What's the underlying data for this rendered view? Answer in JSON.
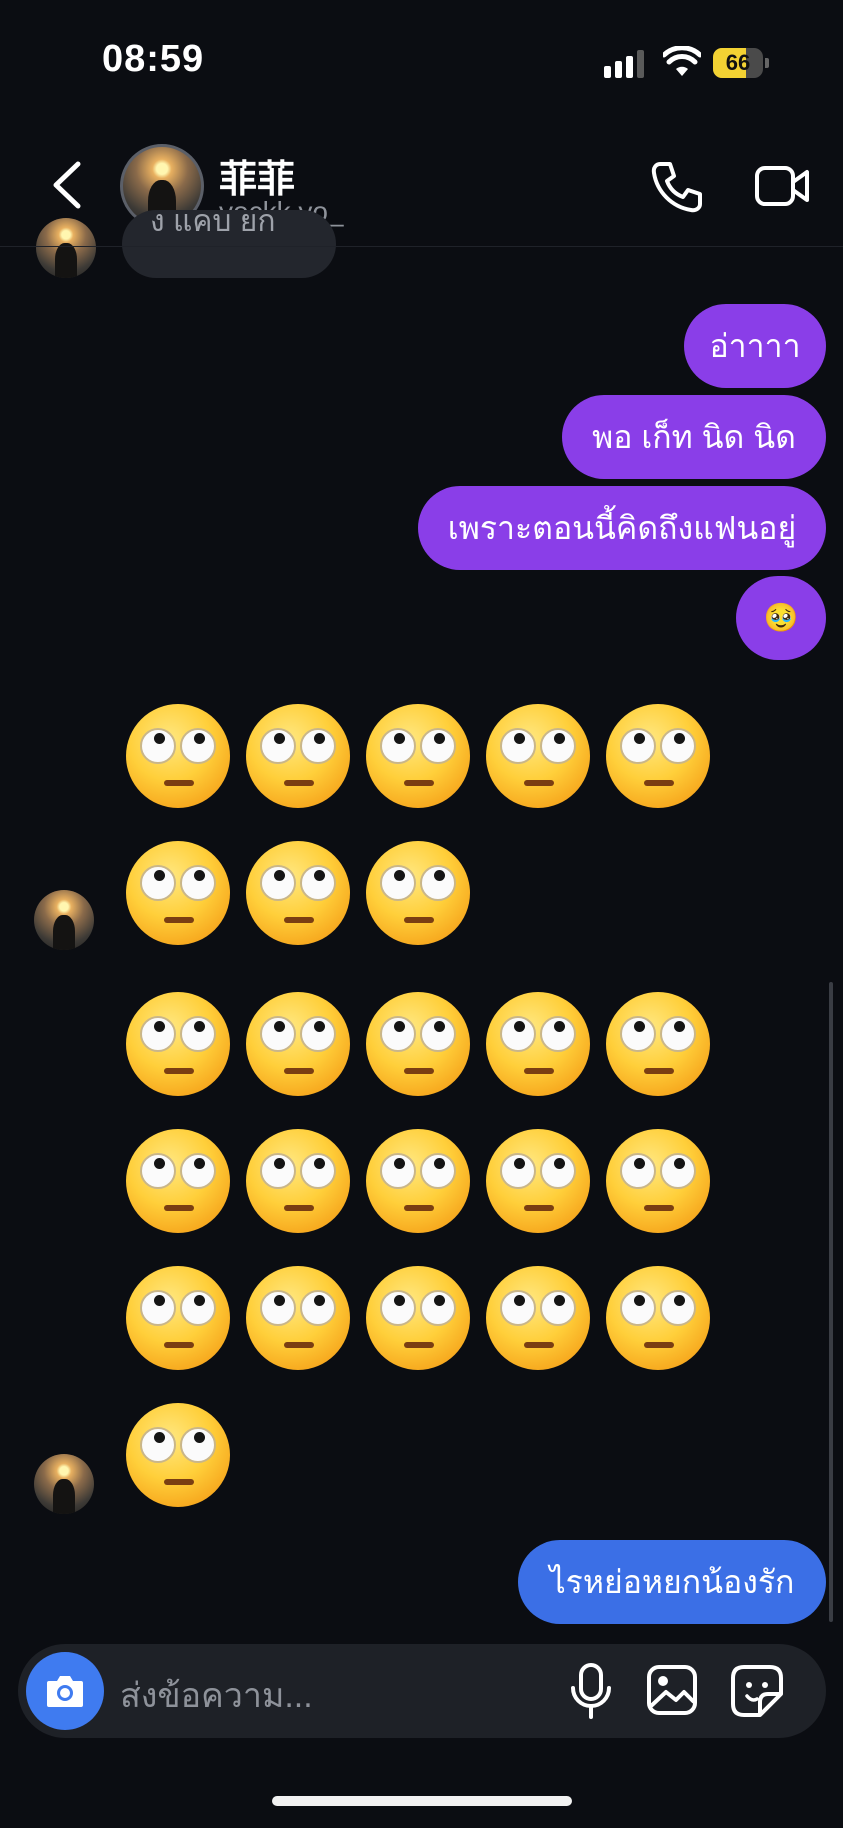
{
  "status_bar": {
    "time": "08:59",
    "battery": "66",
    "battery_level": 0.66
  },
  "header": {
    "name": "菲菲",
    "username": "yockk.yo_"
  },
  "messages": {
    "received_partial": "ง แคบ ยก",
    "sent_1": "อ่าาาา",
    "sent_2": "พอ เก็ท นิด นิด",
    "sent_3": "เพราะตอนนี้คิดถึงแฟนอยู่",
    "sent_4": "🥹",
    "sent_last": "ไรหย่อหยกน้องรัก"
  },
  "emoji_groups": [
    {
      "emoji": "face-with-rolling-eyes",
      "count": 8
    },
    {
      "emoji": "face-with-rolling-eyes",
      "count": 16
    }
  ],
  "composer": {
    "placeholder": "ส่งข้อความ..."
  },
  "colors": {
    "sent_purple": "#8a3ee8",
    "sent_blue": "#3b6fe6",
    "background": "#0b0d12",
    "camera_blue": "#3f7bf0"
  }
}
